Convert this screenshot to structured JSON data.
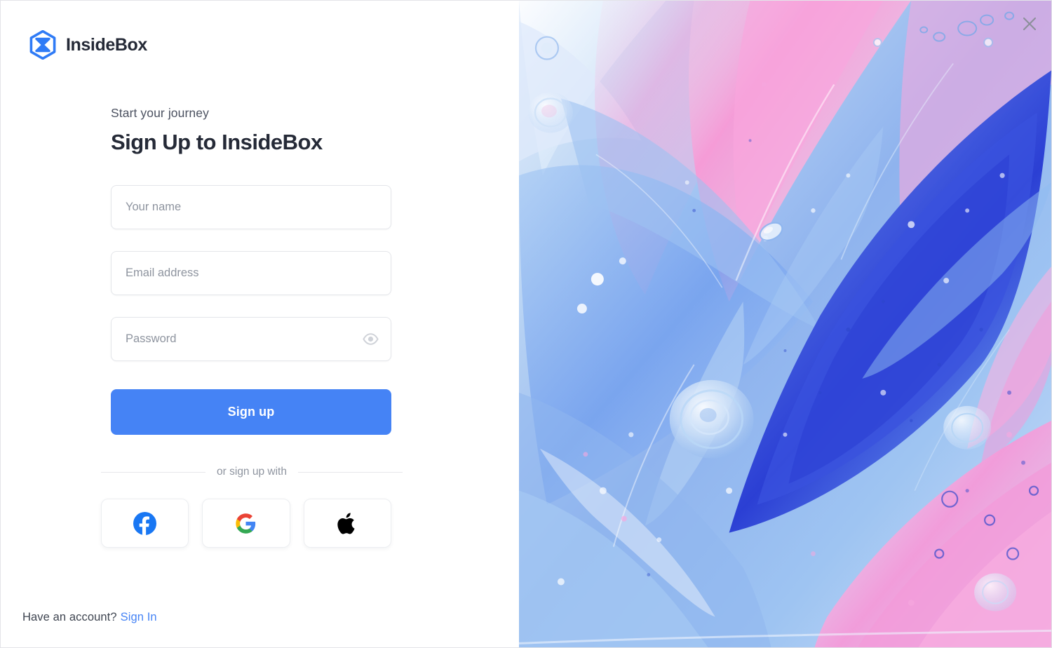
{
  "brand": {
    "name": "InsideBox",
    "logo_icon": "hexagon-bowtie-icon",
    "logo_color": "#2f7bf6"
  },
  "form": {
    "eyebrow": "Start your journey",
    "headline": "Sign Up to InsideBox",
    "fields": [
      {
        "name": "full-name",
        "placeholder": "Your name",
        "value": ""
      },
      {
        "name": "email",
        "placeholder": "Email address",
        "value": ""
      },
      {
        "name": "password",
        "placeholder": "Password",
        "value": "",
        "toggle_icon": "eye-icon"
      }
    ],
    "submit_label": "Sign up",
    "submit_color": "#4583f5"
  },
  "divider": {
    "text": "or sign up with"
  },
  "social": {
    "providers": [
      {
        "name": "facebook",
        "icon": "facebook-icon",
        "color": "#1977f3"
      },
      {
        "name": "google",
        "icon": "google-icon",
        "color": "#4285f4"
      },
      {
        "name": "apple",
        "icon": "apple-icon",
        "color": "#000000"
      }
    ]
  },
  "footer": {
    "prompt": "Have an account?",
    "link_label": "Sign In",
    "link_color": "#4583f5"
  },
  "window": {
    "close_icon": "close-icon"
  },
  "artwork": {
    "description": "abstract fluid marble paint swirls",
    "palette": [
      "#f5a9dd",
      "#f7c3e6",
      "#8fb9ef",
      "#5b79e8",
      "#2f46d8",
      "#b9d6f5",
      "#ffffff"
    ]
  }
}
